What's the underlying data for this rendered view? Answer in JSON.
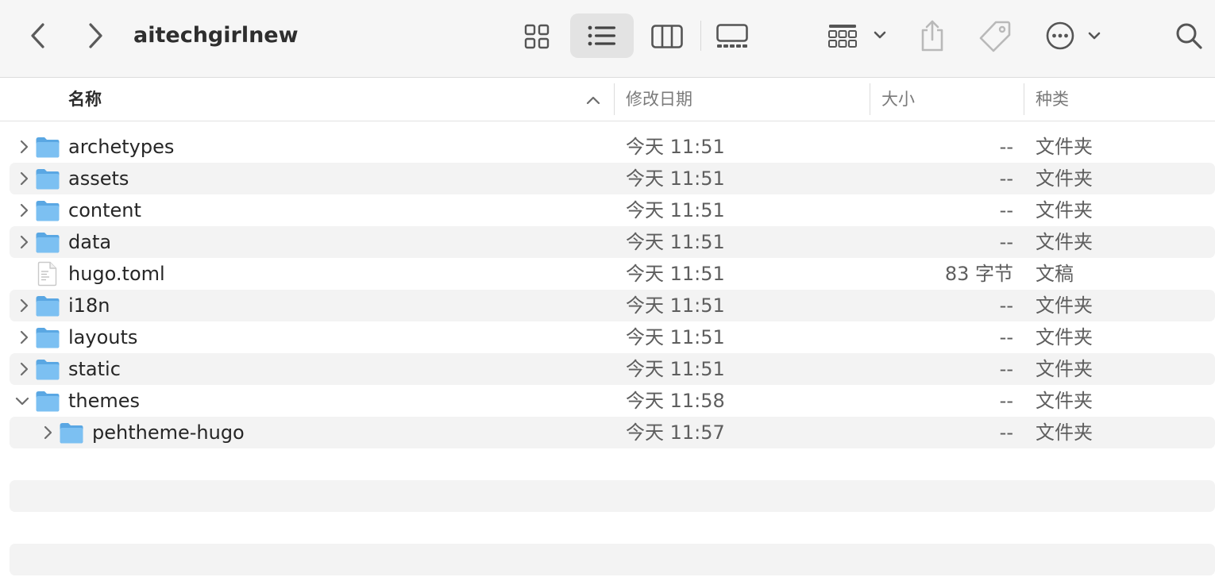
{
  "window": {
    "title": "aitechgirlnew"
  },
  "toolbar": {
    "icons": [
      "chevron-left-icon",
      "chevron-right-icon",
      "grid-view-icon",
      "list-view-icon",
      "column-view-icon",
      "gallery-view-icon",
      "group-icon",
      "share-icon",
      "tag-icon",
      "more-icon",
      "search-icon"
    ],
    "active_view": "list"
  },
  "columns": {
    "name": "名称",
    "date": "修改日期",
    "size": "大小",
    "kind": "种类"
  },
  "files": [
    {
      "name": "archetypes",
      "date": "今天 11:51",
      "size": "--",
      "kind": "文件夹",
      "type": "folder",
      "expanded": false,
      "level": 0
    },
    {
      "name": "assets",
      "date": "今天 11:51",
      "size": "--",
      "kind": "文件夹",
      "type": "folder",
      "expanded": false,
      "level": 0
    },
    {
      "name": "content",
      "date": "今天 11:51",
      "size": "--",
      "kind": "文件夹",
      "type": "folder",
      "expanded": false,
      "level": 0
    },
    {
      "name": "data",
      "date": "今天 11:51",
      "size": "--",
      "kind": "文件夹",
      "type": "folder",
      "expanded": false,
      "level": 0
    },
    {
      "name": "hugo.toml",
      "date": "今天 11:51",
      "size": "83 字节",
      "kind": "文稿",
      "type": "file",
      "expanded": false,
      "level": 0
    },
    {
      "name": "i18n",
      "date": "今天 11:51",
      "size": "--",
      "kind": "文件夹",
      "type": "folder",
      "expanded": false,
      "level": 0
    },
    {
      "name": "layouts",
      "date": "今天 11:51",
      "size": "--",
      "kind": "文件夹",
      "type": "folder",
      "expanded": false,
      "level": 0
    },
    {
      "name": "static",
      "date": "今天 11:51",
      "size": "--",
      "kind": "文件夹",
      "type": "folder",
      "expanded": false,
      "level": 0
    },
    {
      "name": "themes",
      "date": "今天 11:58",
      "size": "--",
      "kind": "文件夹",
      "type": "folder",
      "expanded": true,
      "level": 0
    },
    {
      "name": "pehtheme-hugo",
      "date": "今天 11:57",
      "size": "--",
      "kind": "文件夹",
      "type": "folder",
      "expanded": false,
      "level": 1
    }
  ],
  "colors": {
    "folder": "#7cc0f2",
    "folder_tab": "#5aa7e3",
    "stripe": "#f3f3f3",
    "toolbar_bg": "#f6f6f6"
  }
}
